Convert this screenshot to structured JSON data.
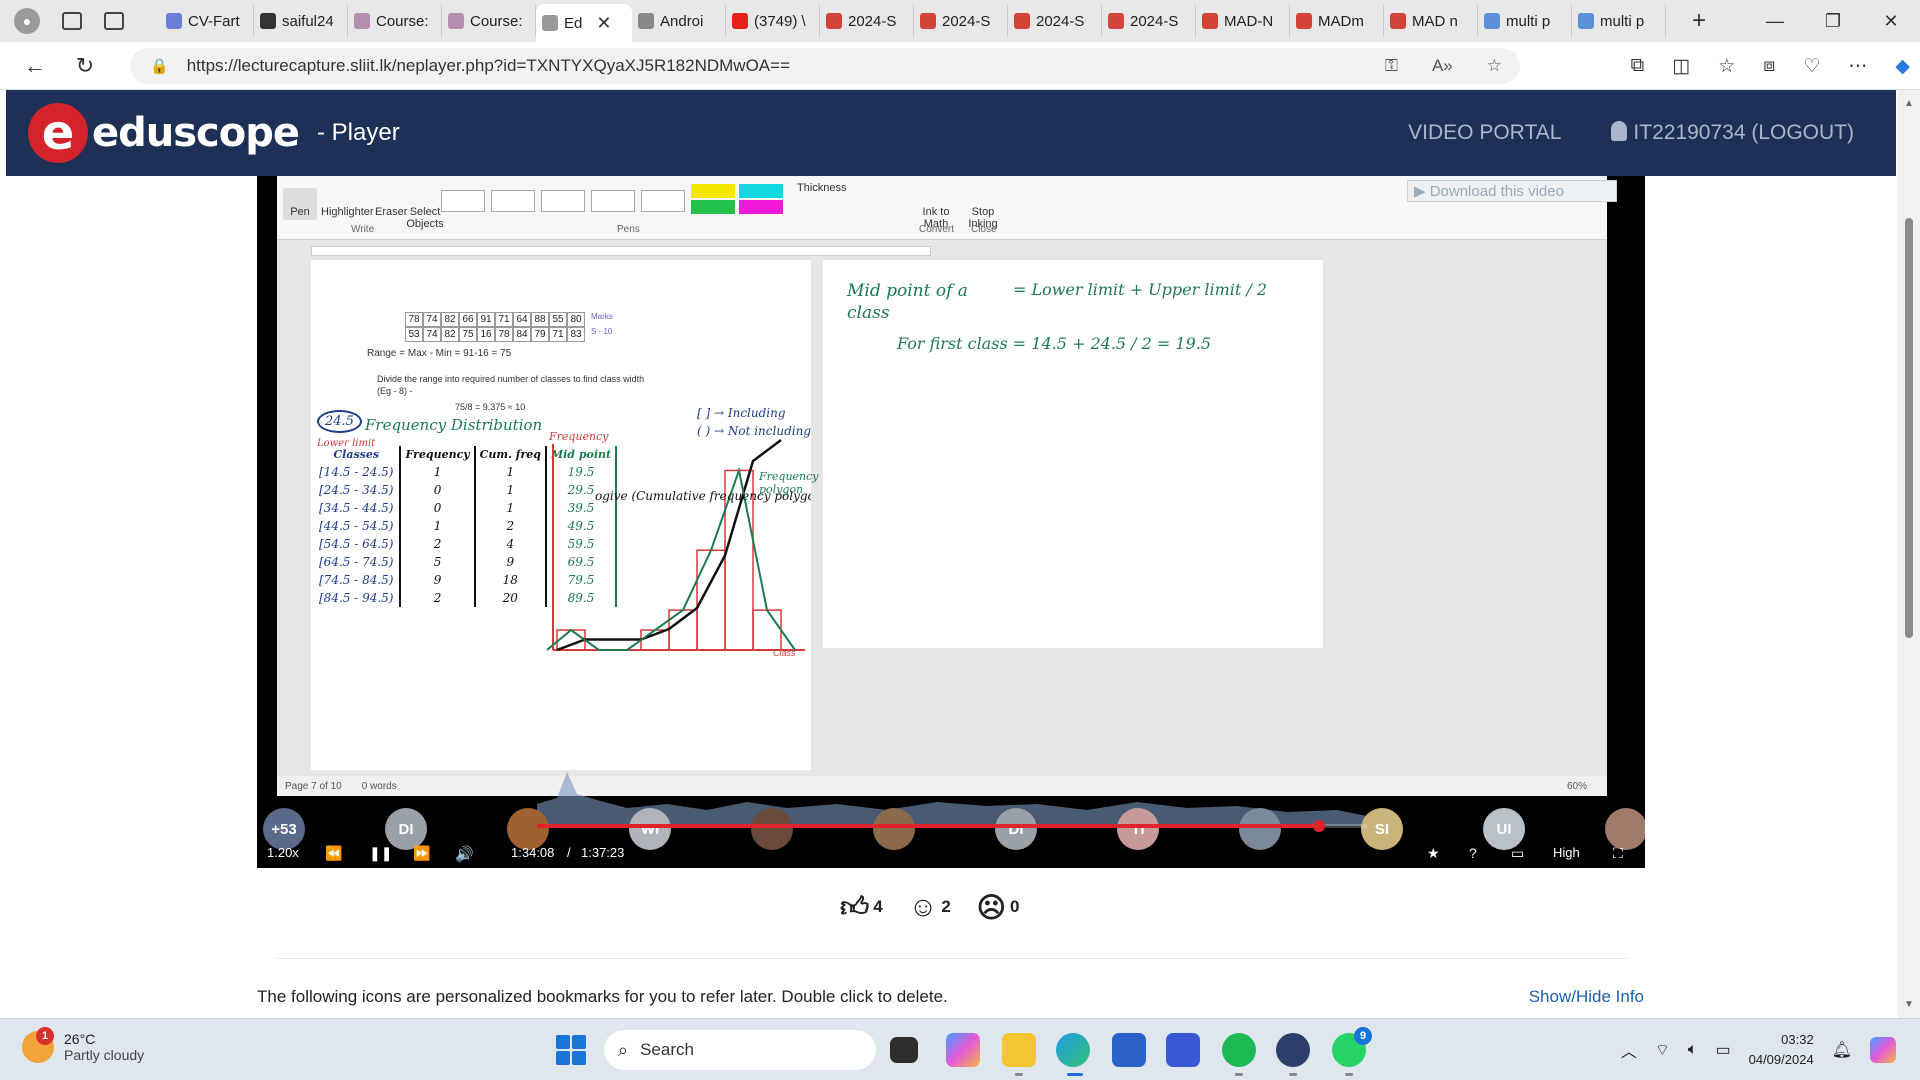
{
  "browser": {
    "tabs": [
      {
        "label": "CV-Fart",
        "color": "#6c7fd8"
      },
      {
        "label": "saiful24",
        "color": "#333333"
      },
      {
        "label": "Course:",
        "color": "#b48fb0"
      },
      {
        "label": "Course:",
        "color": "#b48fb0"
      },
      {
        "label": "Ed",
        "color": "#999999",
        "active": true
      },
      {
        "label": "Androi",
        "color": "#888888"
      },
      {
        "label": "(3749) \\",
        "color": "#e62117"
      },
      {
        "label": "2024-S",
        "color": "#d3443a"
      },
      {
        "label": "2024-S",
        "color": "#d3443a"
      },
      {
        "label": "2024-S",
        "color": "#d3443a"
      },
      {
        "label": "2024-S",
        "color": "#d3443a"
      },
      {
        "label": "MAD-N",
        "color": "#d3443a"
      },
      {
        "label": "MADm",
        "color": "#d3443a"
      },
      {
        "label": "MAD n",
        "color": "#d3443a"
      },
      {
        "label": "multi p",
        "color": "#5b8fd8"
      },
      {
        "label": "multi p",
        "color": "#5b8fd8"
      }
    ],
    "url": "https://lecturecapture.sliit.lk/neplayer.php?id=TXNTYXQyaXJ5R182NDMwOA=="
  },
  "header": {
    "logo_letter": "e",
    "logo_text": "eduscope",
    "subtitle": "- Player",
    "video_portal": "VIDEO PORTAL",
    "user": "IT22190734 (LOGOUT)"
  },
  "ribbon": {
    "pen": "Pen",
    "highlighter": "Highlighter",
    "eraser": "Eraser",
    "select": "Select Objects",
    "group_write": "Write",
    "group_pens": "Pens",
    "thickness": "Thickness",
    "ink_to_math": "Ink to Math",
    "stop_inking": "Stop Inking",
    "group_convert": "Convert",
    "group_close": "Close",
    "download": "Download this video"
  },
  "document": {
    "marks_row1": [
      "78",
      "74",
      "82",
      "66",
      "91",
      "71",
      "64",
      "88",
      "55",
      "80"
    ],
    "marks_row2": [
      "53",
      "74",
      "82",
      "75",
      "16",
      "78",
      "84",
      "79",
      "71",
      "83"
    ],
    "marks_label": "Marks",
    "row2_note": "S - 10",
    "range_text": "Range = Max - Min = 91-16 = 75",
    "divide_text": "Divide the range into required number of classes to find class width",
    "eg_text": "(Eg - 8) -",
    "calc_text": "75/8 = 9.375 ≈ 10",
    "dist_title": "Frequency Distribution",
    "circled": "24.5",
    "lower_limit": "Lower limit",
    "col_classes": "Classes",
    "col_freq": "Frequency",
    "col_cum": "Cum. freq",
    "col_mid": "Mid point",
    "rows": [
      {
        "cls": "[14.5 - 24.5)",
        "f": "1",
        "c": "1",
        "m": "19.5"
      },
      {
        "cls": "[24.5 - 34.5)",
        "f": "0",
        "c": "1",
        "m": "29.5"
      },
      {
        "cls": "[34.5 - 44.5)",
        "f": "0",
        "c": "1",
        "m": "39.5"
      },
      {
        "cls": "[44.5 - 54.5)",
        "f": "1",
        "c": "2",
        "m": "49.5"
      },
      {
        "cls": "[54.5 - 64.5)",
        "f": "2",
        "c": "4",
        "m": "59.5"
      },
      {
        "cls": "[64.5 - 74.5)",
        "f": "5",
        "c": "9",
        "m": "69.5"
      },
      {
        "cls": "[74.5 - 84.5)",
        "f": "9",
        "c": "18",
        "m": "79.5"
      },
      {
        "cls": "[84.5 - 94.5)",
        "f": "2",
        "c": "20",
        "m": "89.5"
      }
    ],
    "graph_ylabel": "Frequency",
    "graph_xlabel": "Class",
    "ogive_label": "ogive (Cumulative frequency polygon)",
    "poly_label": "Frequency polygon",
    "bracket_incl": "[ ] → Including",
    "bracket_excl": "( ) → Not including",
    "mid_title": "Mid point of a class",
    "mid_formula": "= Lower limit + Upper limit / 2",
    "first_class": "For first class  =  14.5 + 24.5 / 2  =  19.5",
    "status_page": "Page 7 of 10",
    "status_words": "0 words",
    "zoom": "60%"
  },
  "player": {
    "speed": "1.20x",
    "current_time": "1:34:08",
    "separator": "/",
    "duration": "1:37:23",
    "quality": "High",
    "progress": 0.942,
    "participants": [
      {
        "initials": "+53",
        "color": "#5a6a8a"
      },
      {
        "initials": "DI",
        "color": "#9aa0a8"
      },
      {
        "initials": "",
        "color": "#a06030"
      },
      {
        "initials": "WI",
        "color": "#b0b4ba"
      },
      {
        "initials": "",
        "color": "#6a4a3a"
      },
      {
        "initials": "",
        "color": "#8a6a4a"
      },
      {
        "initials": "DI",
        "color": "#9aa0a8"
      },
      {
        "initials": "TI",
        "color": "#c79a9a"
      },
      {
        "initials": "",
        "color": "#7a8a9a"
      },
      {
        "initials": "SI",
        "color": "#c9b47a"
      },
      {
        "initials": "UI",
        "color": "#b8c0c8"
      },
      {
        "initials": "",
        "color": "#a07a6a"
      }
    ]
  },
  "reactions": {
    "likes": "4",
    "smiles": "2",
    "confused": "0"
  },
  "info": {
    "text": "The following icons are personalized bookmarks for you to refer later. Double click to delete.",
    "link": "Show/Hide Info"
  },
  "taskbar": {
    "temp": "26°C",
    "weather": "Partly cloudy",
    "weather_badge": "1",
    "search": "Search",
    "time": "03:32",
    "date": "04/09/2024",
    "whatsapp_badge": "9"
  }
}
